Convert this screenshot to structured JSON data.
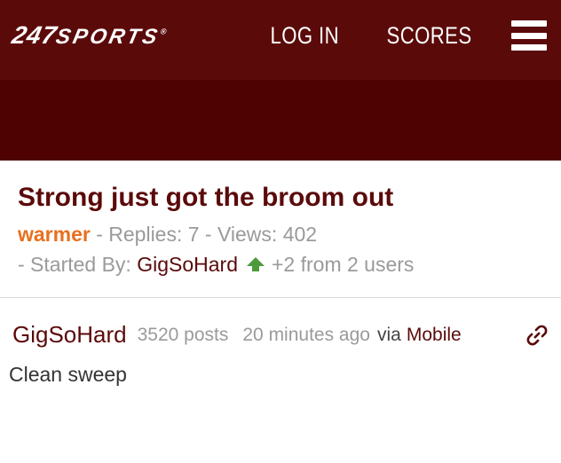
{
  "header": {
    "logo_text": "247",
    "logo_suffix": "SPORTS",
    "login_label": "LOG IN",
    "scores_label": "SCORES",
    "brand_color": "#5b0a0a"
  },
  "thread": {
    "title": "Strong just got the broom out",
    "forum": "warmer",
    "replies_text": " - Replies: 7 - Views: 402",
    "started_by_text": "- Started By: ",
    "author": "GigSoHard",
    "reactions_text": "+2 from 2 users"
  },
  "post": {
    "poster": "GigSoHard",
    "posts_count": "3520 posts",
    "time": "20 minutes ago",
    "via_label": "via",
    "platform": "Mobile",
    "body": "Clean sweep"
  }
}
